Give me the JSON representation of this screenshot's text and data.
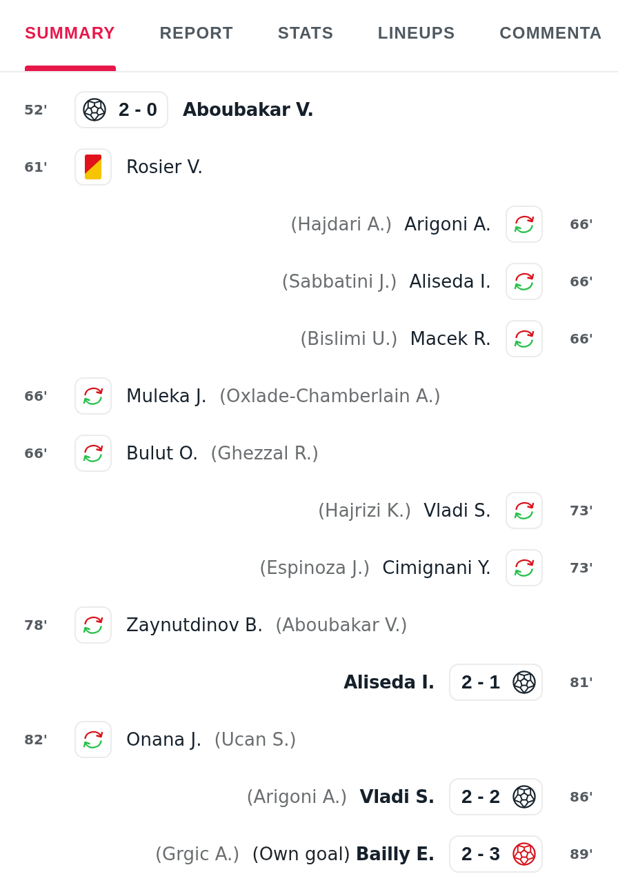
{
  "tabs": [
    {
      "label": "SUMMARY",
      "selected": true
    },
    {
      "label": "REPORT",
      "selected": false
    },
    {
      "label": "STATS",
      "selected": false
    },
    {
      "label": "LINEUPS",
      "selected": false
    },
    {
      "label": "COMMENTA",
      "selected": false
    }
  ],
  "events": [
    {
      "away": false,
      "kind": "goal",
      "minute": "52'",
      "score": "2 - 0",
      "player": "Aboubakar V."
    },
    {
      "away": false,
      "kind": "second_yellow",
      "minute": "61'",
      "player": "Rosier V."
    },
    {
      "away": true,
      "kind": "substitution",
      "minute": "66'",
      "player": "Arigoni A.",
      "secondary": "(Hajdari A.)"
    },
    {
      "away": true,
      "kind": "substitution",
      "minute": "66'",
      "player": "Aliseda I.",
      "secondary": "(Sabbatini J.)"
    },
    {
      "away": true,
      "kind": "substitution",
      "minute": "66'",
      "player": "Macek R.",
      "secondary": "(Bislimi U.)"
    },
    {
      "away": false,
      "kind": "substitution",
      "minute": "66'",
      "player": "Muleka J.",
      "secondary": "(Oxlade-Chamberlain A.)"
    },
    {
      "away": false,
      "kind": "substitution",
      "minute": "66'",
      "player": "Bulut O.",
      "secondary": "(Ghezzal R.)"
    },
    {
      "away": true,
      "kind": "substitution",
      "minute": "73'",
      "player": "Vladi S.",
      "secondary": "(Hajrizi K.)"
    },
    {
      "away": true,
      "kind": "substitution",
      "minute": "73'",
      "player": "Cimignani Y.",
      "secondary": "(Espinoza J.)"
    },
    {
      "away": false,
      "kind": "substitution",
      "minute": "78'",
      "player": "Zaynutdinov B.",
      "secondary": "(Aboubakar V.)"
    },
    {
      "away": true,
      "kind": "goal",
      "minute": "81'",
      "score": "2 - 1",
      "player": "Aliseda I."
    },
    {
      "away": false,
      "kind": "substitution",
      "minute": "82'",
      "player": "Onana J.",
      "secondary": "(Ucan S.)"
    },
    {
      "away": true,
      "kind": "goal",
      "minute": "86'",
      "score": "2 - 2",
      "player": "Vladi S.",
      "secondary": "(Arigoni A.)"
    },
    {
      "away": true,
      "kind": "own_goal",
      "minute": "89'",
      "score": "2 - 3",
      "player": "Bailly E.",
      "note": "(Own goal)",
      "secondary": "(Grgic A.)"
    }
  ]
}
